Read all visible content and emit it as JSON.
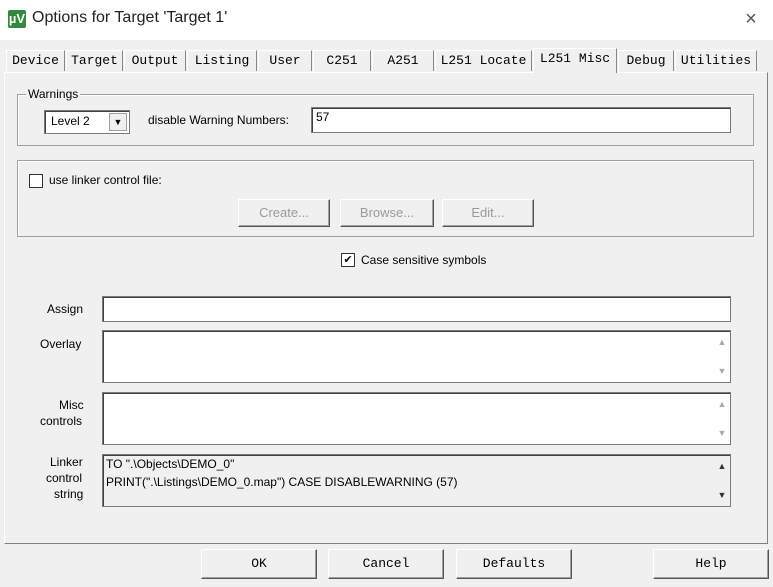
{
  "window": {
    "title": "Options for Target 'Target 1'",
    "app_icon": "µV",
    "close_symbol": "×"
  },
  "tabs": [
    {
      "label": "Device"
    },
    {
      "label": "Target"
    },
    {
      "label": "Output"
    },
    {
      "label": "Listing"
    },
    {
      "label": "User"
    },
    {
      "label": "C251"
    },
    {
      "label": "A251"
    },
    {
      "label": "L251 Locate"
    },
    {
      "label": "L251 Misc"
    },
    {
      "label": "Debug"
    },
    {
      "label": "Utilities"
    }
  ],
  "active_tab": "L251 Misc",
  "warnings": {
    "legend": "Warnings",
    "level_value": "Level 2",
    "disable_label": "disable Warning Numbers:",
    "disable_value": "57"
  },
  "linker_control": {
    "checkbox_label": "use linker control file:",
    "checked": false,
    "create_label": "Create...",
    "browse_label": "Browse...",
    "edit_label": "Edit..."
  },
  "case_sensitive": {
    "label": "Case sensitive symbols",
    "checked": true,
    "check_mark": "✔"
  },
  "assign": {
    "label": "Assign",
    "value": ""
  },
  "overlay": {
    "label": "Overlay",
    "value": ""
  },
  "misc_controls": {
    "label_line1": "Misc",
    "label_line2": "controls",
    "value": ""
  },
  "linker_string": {
    "label_line1": "Linker",
    "label_line2": "control",
    "label_line3": "string",
    "line1": "TO \".\\Objects\\DEMO_0\"",
    "line2": "PRINT(\".\\Listings\\DEMO_0.map\") CASE DISABLEWARNING (57)"
  },
  "scroll_arrows": {
    "up": "▲",
    "down": "▼",
    "combo": "▼"
  },
  "footer": {
    "ok": "OK",
    "cancel": "Cancel",
    "defaults": "Defaults",
    "help": "Help"
  }
}
